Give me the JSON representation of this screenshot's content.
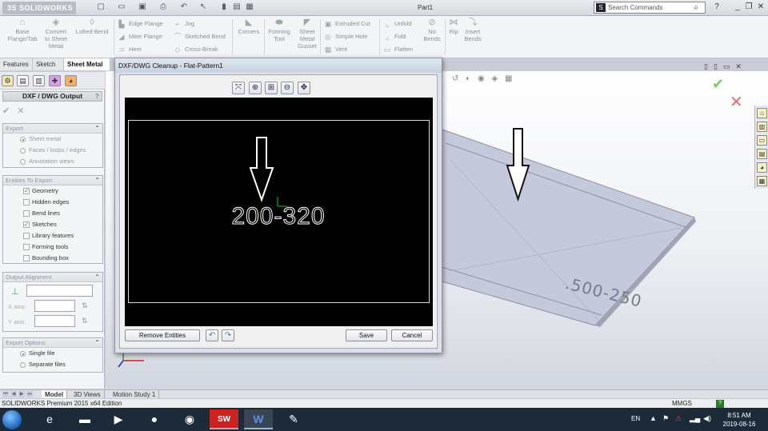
{
  "app": {
    "logo_text": "3S SOLIDWORKS",
    "document_title": "Part1",
    "search_placeholder": "Search Commands",
    "search_icon_label": "S"
  },
  "ribbon": {
    "big_buttons": [
      {
        "label": "Base\nFlange/Tab",
        "icon": "base-flange-icon"
      },
      {
        "label": "Convert\nto Sheet\nMetal",
        "icon": "convert-sheet-metal-icon"
      },
      {
        "label": "Lofted-Bend",
        "icon": "lofted-bend-icon"
      }
    ],
    "col1": [
      "Edge Flange",
      "Miter Flange",
      "Hem"
    ],
    "col2": [
      "Jog",
      "Sketched Bend",
      "Cross-Break"
    ],
    "corners_label": "Corners",
    "forming_tool_label": "Forming\nTool",
    "gusset_label": "Sheet\nMetal\nGusset",
    "col3": [
      "Extruded Cut",
      "Simple Hole",
      "Vent"
    ],
    "col4": [
      "Unfold",
      "Fold",
      "Flatten"
    ],
    "no_bends_label": "No\nBends",
    "rip_label": "Rip",
    "insert_bends_label": "Insert\nBends"
  },
  "command_tabs": [
    "Features",
    "Sketch",
    "Sheet Metal"
  ],
  "property_manager": {
    "title": "DXF / DWG Output",
    "help_glyph": "?",
    "ok_glyph": "✔",
    "cancel_glyph": "✕",
    "export": {
      "header": "Export",
      "options": [
        "Sheet metal",
        "Faces / loops / edges",
        "Annotation views"
      ],
      "selected": "Sheet metal"
    },
    "entities": {
      "header": "Entities To Export",
      "items": [
        {
          "label": "Geometry",
          "checked": true
        },
        {
          "label": "Hidden edges",
          "checked": false
        },
        {
          "label": "Bend lines",
          "checked": false
        },
        {
          "label": "Sketches",
          "checked": true
        },
        {
          "label": "Library features",
          "checked": false
        },
        {
          "label": "Forming tools",
          "checked": false
        },
        {
          "label": "Bounding box",
          "checked": false
        }
      ]
    },
    "alignment": {
      "header": "Output Alignment",
      "x_axis_label": "X axis:",
      "y_axis_label": "Y axis:"
    },
    "export_options": {
      "header": "Export Options",
      "options": [
        "Single file",
        "Separate files"
      ],
      "selected": "Single file"
    }
  },
  "dialog": {
    "title": "DXF/DWG Cleanup - Flat-Pattern1",
    "preview_text": "200-320",
    "remove_entities_label": "Remove Entities",
    "save_label": "Save",
    "cancel_label": "Cancel"
  },
  "viewport": {
    "embossed_text": ".500-250"
  },
  "bottom_tabs": [
    "Model",
    "3D Views",
    "Motion Study 1"
  ],
  "status": {
    "edition": "SOLIDWORKS Premium 2015 x64 Edition",
    "units": "MMGS",
    "help_glyph": "?"
  },
  "taskbar": {
    "apps": [
      {
        "name": "internet-explorer-icon",
        "glyph": "e",
        "running": false
      },
      {
        "name": "file-explorer-icon",
        "glyph": "▬",
        "running": false
      },
      {
        "name": "media-player-icon",
        "glyph": "▶",
        "running": false
      },
      {
        "name": "chrome-icon",
        "glyph": "●",
        "running": false
      },
      {
        "name": "firefox-icon",
        "glyph": "◉",
        "running": false
      },
      {
        "name": "solidworks-2015-icon",
        "glyph": "SW",
        "running": true
      },
      {
        "name": "word-icon",
        "glyph": "W",
        "running": true
      },
      {
        "name": "paint-icon",
        "glyph": "✎",
        "running": false
      }
    ],
    "language": "EN",
    "time": "8:51 AM",
    "date": "2019-08-16"
  },
  "colors": {
    "preview_background": "#000000",
    "sheet_face": "#c4c8dc",
    "confirm_green": "#7dcc62",
    "cancel_red": "#e07070"
  }
}
